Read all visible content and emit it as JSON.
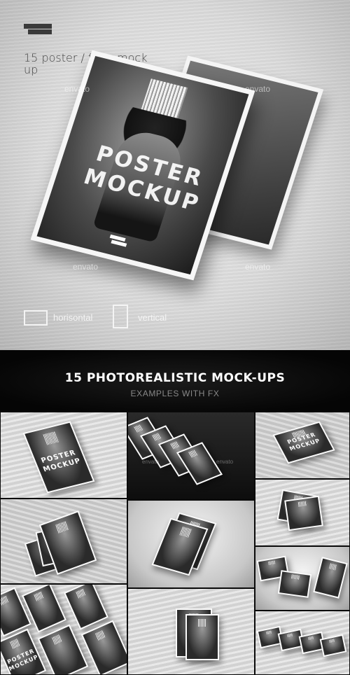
{
  "hero": {
    "title": "15 poster / flyer mock up",
    "watermark": "envato",
    "poster_line1": "POSTER",
    "poster_line2": "MOCKUP",
    "orientation_horizontal": "horisontal",
    "orientation_vertical": "vertical"
  },
  "banner": {
    "title": "15 PHOTOREALISTIC MOCK-UPS",
    "subtitle": "EXAMPLES WITH FX"
  },
  "grid": {
    "poster_line1": "POSTER",
    "poster_line2": "MOCKUP",
    "watermark": "envato"
  },
  "colors": {
    "banner_bg": "#050505",
    "hero_bg": "#dcdcdc",
    "poster_dark": "#2a2a2a"
  }
}
